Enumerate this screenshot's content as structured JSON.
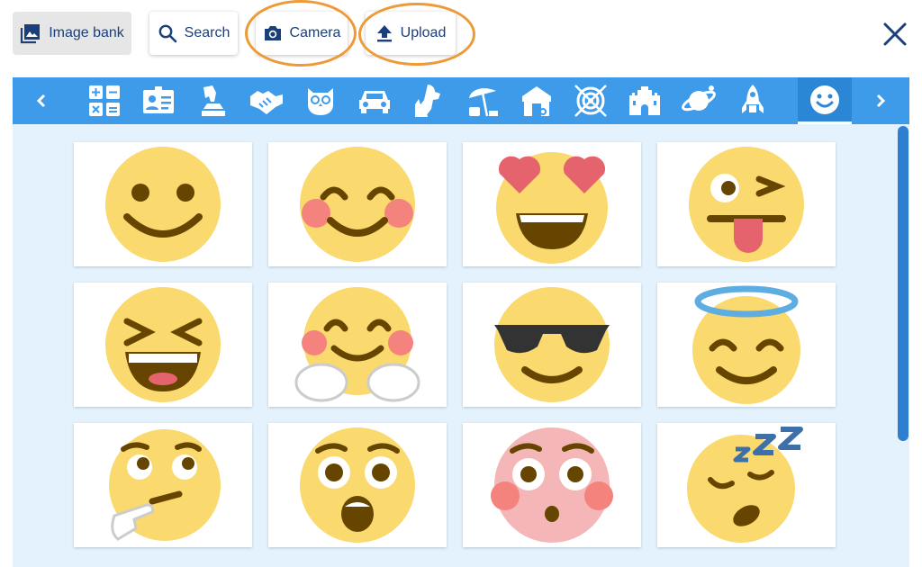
{
  "toolbar": {
    "image_bank_label": "Image bank",
    "search_label": "Search",
    "camera_label": "Camera",
    "upload_label": "Upload"
  },
  "categories": [
    {
      "icon": "math-operators-icon"
    },
    {
      "icon": "id-card-icon"
    },
    {
      "icon": "statue-icon"
    },
    {
      "icon": "handshake-icon"
    },
    {
      "icon": "owl-icon"
    },
    {
      "icon": "car-icon"
    },
    {
      "icon": "dog-cat-icon"
    },
    {
      "icon": "beach-umbrella-icon"
    },
    {
      "icon": "barn-icon"
    },
    {
      "icon": "target-icon"
    },
    {
      "icon": "castle-icon"
    },
    {
      "icon": "planet-icon"
    },
    {
      "icon": "rocket-icon"
    },
    {
      "icon": "smiley-icon",
      "selected": true
    }
  ],
  "emojis": [
    "slightly-smiling-face",
    "smiling-blushing-face",
    "heart-eyes-face",
    "winking-tongue-face",
    "grinning-squinting-face",
    "hugging-face",
    "sunglasses-face",
    "halo-face",
    "thinking-face",
    "surprised-face",
    "flushed-face",
    "sleeping-face"
  ],
  "colors": {
    "accent_blue": "#3d9be9",
    "grid_background": "#e3f2fc",
    "highlight_ring": "#ef9a38",
    "button_text": "#1b3f7a",
    "emoji_yellow": "#fad96e"
  }
}
